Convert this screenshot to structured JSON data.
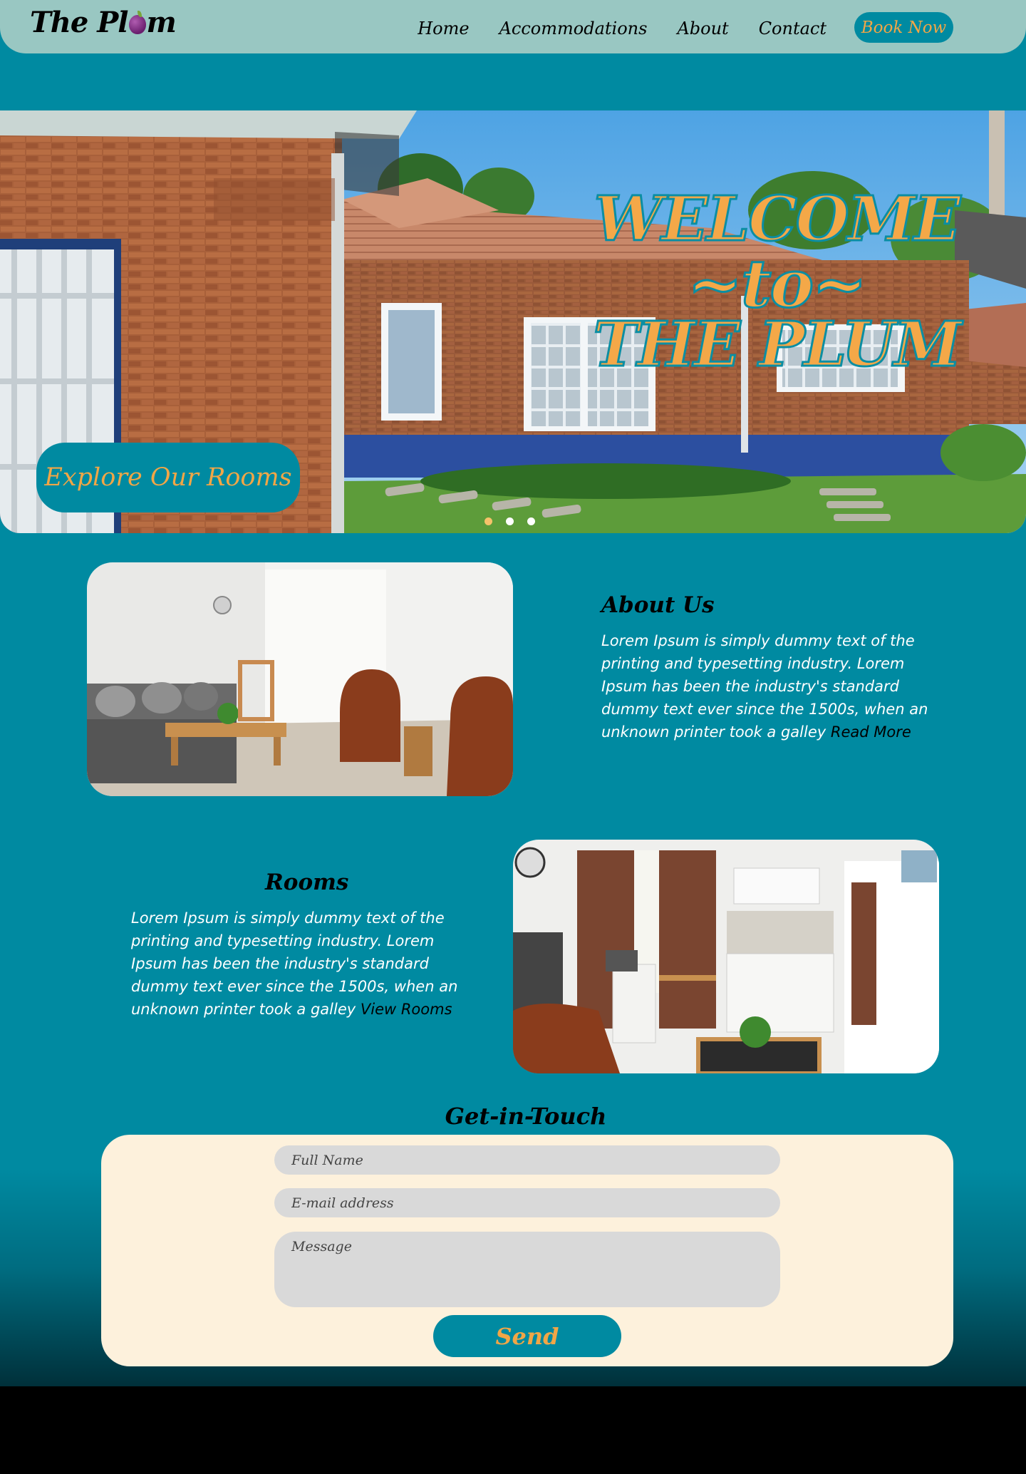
{
  "brand": {
    "logo_prefix": "The Pl",
    "logo_suffix": "m"
  },
  "nav": {
    "items": [
      {
        "label": "Home"
      },
      {
        "label": "Accommodations"
      },
      {
        "label": "About"
      },
      {
        "label": "Contact"
      }
    ],
    "book_now": "Book Now"
  },
  "hero": {
    "line1": "WELCOME",
    "line2": "~to~",
    "line3": "THE PLUM",
    "cta": "Explore Our Rooms",
    "slides": [
      {
        "active": true
      },
      {
        "active": false
      },
      {
        "active": false
      }
    ]
  },
  "about": {
    "title": "About Us",
    "text": "Lorem Ipsum is simply dummy text of the printing and typesetting industry. Lorem Ipsum has been the industry's standard dummy text ever since the 1500s, when an unknown printer took a galley ",
    "link": "Read More"
  },
  "rooms": {
    "title": "Rooms",
    "text": "Lorem Ipsum is simply dummy text of the printing and typesetting industry. Lorem Ipsum has been the industry's standard dummy text ever since the 1500s, when an unknown printer took a galley ",
    "link": "View Rooms"
  },
  "contact": {
    "title": "Get-in-Touch",
    "name_placeholder": "Full Name",
    "email_placeholder": "E-mail address",
    "message_placeholder": "Message",
    "send": "Send"
  },
  "colors": {
    "teal": "#008aa1",
    "nav_bg": "#99c7c2",
    "accent_orange": "#f1a646",
    "form_bg": "#fdf1dc",
    "field_bg": "#d9d9d9"
  }
}
